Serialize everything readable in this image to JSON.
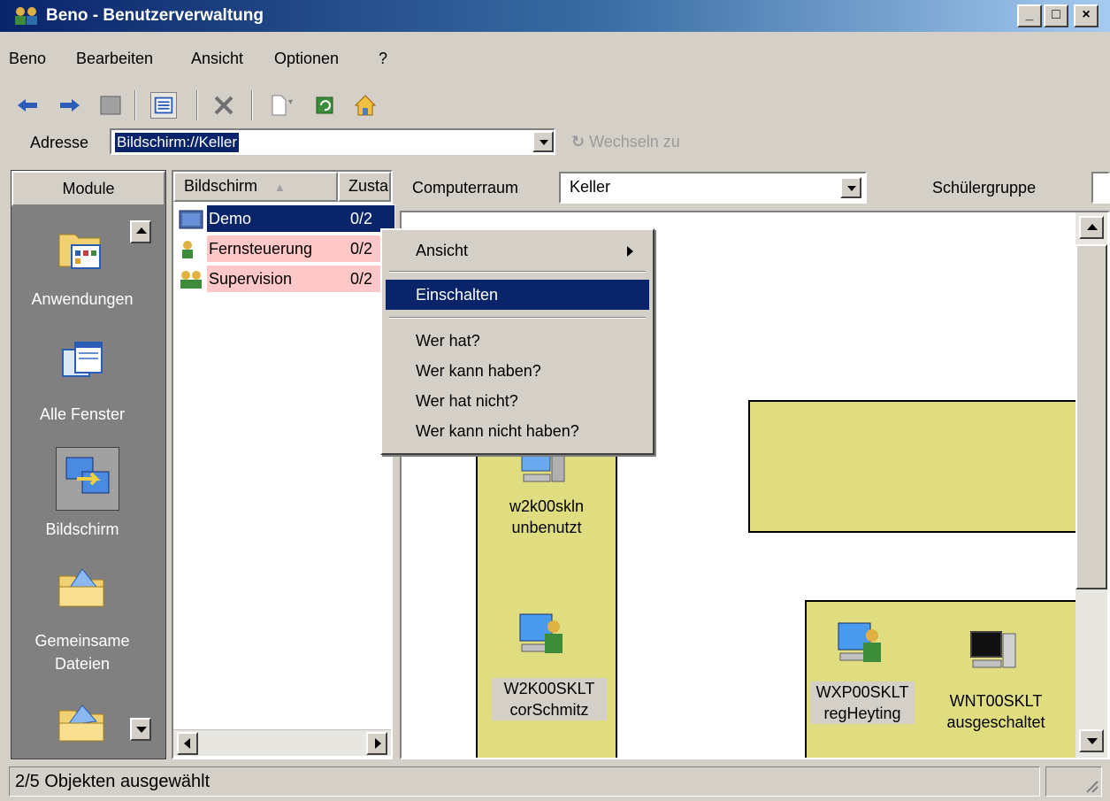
{
  "window": {
    "title": "Beno - Benutzerverwaltung",
    "minimize": "_",
    "maximize": "□",
    "close": "×"
  },
  "menubar": {
    "items": [
      "Beno",
      "Bearbeiten",
      "Ansicht",
      "Optionen",
      "?"
    ]
  },
  "address": {
    "label": "Adresse",
    "value": "Bildschirm://Keller",
    "goto_label": "Wechseln zu"
  },
  "modules": {
    "header": "Module",
    "items": [
      {
        "label": "Anwendungen",
        "icon": "folder-apps-icon"
      },
      {
        "label": "Alle Fenster",
        "icon": "windows-icon"
      },
      {
        "label": "Bildschirm",
        "icon": "screen-icon"
      },
      {
        "label_line1": "Gemeinsame",
        "label_line2": "Dateien",
        "icon": "shared-folder-icon"
      }
    ]
  },
  "list": {
    "columns": [
      "Bildschirm",
      "Zusta"
    ],
    "rows": [
      {
        "label": "Demo",
        "value": "0/2",
        "icon": "demo-screen-icon",
        "state": "selected"
      },
      {
        "label": "Fernsteuerung",
        "value": "0/2",
        "icon": "user-icon",
        "state": "highlighted"
      },
      {
        "label": "Supervision",
        "value": "0/2",
        "icon": "users-icon",
        "state": "highlighted"
      }
    ]
  },
  "room": {
    "label": "Computerraum",
    "value": "Keller",
    "group_label": "Schülergruppe"
  },
  "computers": [
    {
      "name": "w2k00skln",
      "status": "unbenutzt"
    },
    {
      "name": "W2K00SKLT",
      "status": "corSchmitz"
    },
    {
      "name": "WXP00SKLT",
      "status": "regHeyting"
    },
    {
      "name": "WNT00SKLT",
      "status": "ausgeschaltet"
    }
  ],
  "context_menu": {
    "items": [
      "Ansicht",
      "Einschalten",
      "Wer hat?",
      "Wer kann haben?",
      "Wer hat nicht?",
      "Wer kann nicht haben?"
    ],
    "highlighted": "Einschalten"
  },
  "statusbar": {
    "text": "2/5 Objekten ausgewählt"
  },
  "colors": {
    "selection": "#0a246a",
    "row_highlight": "#ffc8c8",
    "room_area": "#dfdd80",
    "face": "#d4d0c8"
  }
}
